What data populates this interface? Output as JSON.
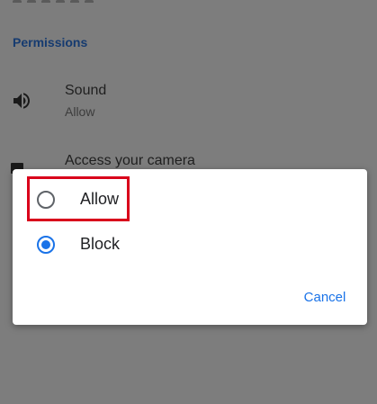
{
  "background": {
    "section_header": "Permissions",
    "permissions": [
      {
        "title": "Sound",
        "value": "Allow",
        "icon": "volume-icon"
      },
      {
        "title": "Access your camera",
        "value": "",
        "icon": "camera-icon"
      }
    ]
  },
  "dialog": {
    "options": [
      {
        "label": "Allow",
        "selected": false
      },
      {
        "label": "Block",
        "selected": true
      }
    ],
    "cancel_label": "Cancel"
  },
  "colors": {
    "accent": "#1a73e8",
    "highlight_border": "#d9001b",
    "scrim": "#7d7d7d"
  }
}
